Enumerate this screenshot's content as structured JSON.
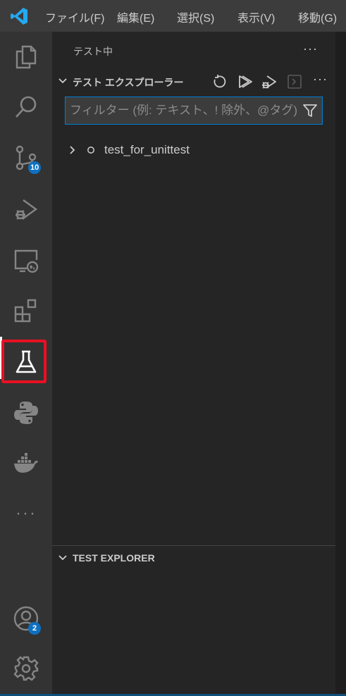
{
  "menu": [
    "ファイル(F)",
    "編集(E)",
    "選択(S)",
    "表示(V)",
    "移動(G)"
  ],
  "activity_bar": {
    "items": [
      {
        "name": "explorer-icon"
      },
      {
        "name": "search-icon"
      },
      {
        "name": "source-control-icon",
        "badge": "10"
      },
      {
        "name": "run-debug-icon"
      },
      {
        "name": "remote-explorer-icon"
      },
      {
        "name": "extensions-icon"
      },
      {
        "name": "testing-flask-icon",
        "active": true
      },
      {
        "name": "python-icon"
      },
      {
        "name": "docker-icon"
      },
      {
        "name": "more-icon",
        "label": "···"
      }
    ],
    "accounts_badge": "2",
    "active_highlight_color": "#e81123"
  },
  "sidebar": {
    "title": "テスト中",
    "more": "···",
    "section1": {
      "label": "テスト エクスプローラー",
      "more": "···",
      "filter_placeholder": "フィルター (例: テキスト、! 除外、@タグ)"
    },
    "tree": [
      {
        "label": "test_for_unittest",
        "status": "circle-outline-icon"
      }
    ],
    "section2": {
      "label": "TEST EXPLORER"
    }
  },
  "colors": {
    "accent": "#007fd4",
    "badge": "#0e70c0",
    "vscode_logo": "#23a9f2"
  }
}
